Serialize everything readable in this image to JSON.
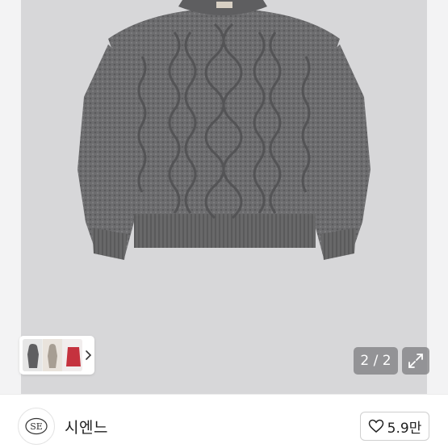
{
  "gallery": {
    "page_indicator": "2 / 2",
    "icons": {
      "thumb_next": "chevron-right-icon",
      "expand": "expand-icon"
    },
    "colors": {
      "sweater": "#6f6f71",
      "background": "#d7d7d9"
    }
  },
  "shop": {
    "logo_text": "SE",
    "name": "시엔느",
    "like_count": "5.9만",
    "like_icon": "heart-outline-icon"
  }
}
